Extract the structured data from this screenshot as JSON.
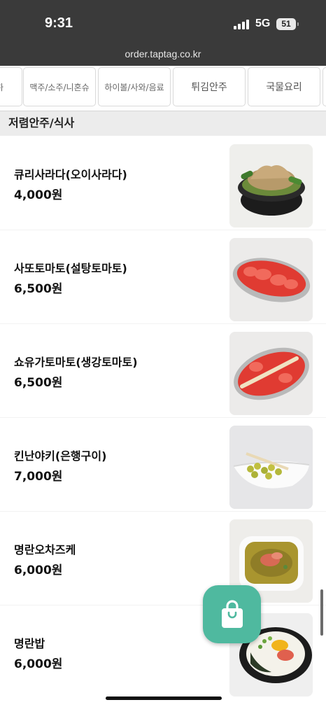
{
  "status_bar": {
    "time": "9:31",
    "network": "5G",
    "battery": "51"
  },
  "browser": {
    "url": "order.taptag.co.kr"
  },
  "category_tabs": [
    {
      "label": "하"
    },
    {
      "label": "맥주/소주/니혼슈"
    },
    {
      "label": "하이볼/사와/음료"
    },
    {
      "label": "튀김안주"
    },
    {
      "label": "국물요리"
    },
    {
      "label": ""
    }
  ],
  "section": {
    "title": "저렴안주/식사"
  },
  "menu_items": [
    {
      "name": "큐리사라다(오이사라다)",
      "price": "4,000원",
      "photo_icon": "cucumber-salad"
    },
    {
      "name": "사또토마토(설탕토마토)",
      "price": "6,500원",
      "photo_icon": "sugar-tomato"
    },
    {
      "name": "쇼유가토마토(생강토마토)",
      "price": "6,500원",
      "photo_icon": "ginger-tomato"
    },
    {
      "name": "킨난야키(은행구이)",
      "price": "7,000원",
      "photo_icon": "ginkgo"
    },
    {
      "name": "명란오차즈케",
      "price": "6,000원",
      "photo_icon": "ochazuke"
    },
    {
      "name": "명란밥",
      "price": "6,000원",
      "photo_icon": "mentaiko-rice"
    }
  ],
  "colors": {
    "accent": "#4fb99f",
    "status_bg": "#3a3a3a",
    "section_bg": "#ececec"
  },
  "cart": {
    "icon": "shopping-bag-icon"
  }
}
